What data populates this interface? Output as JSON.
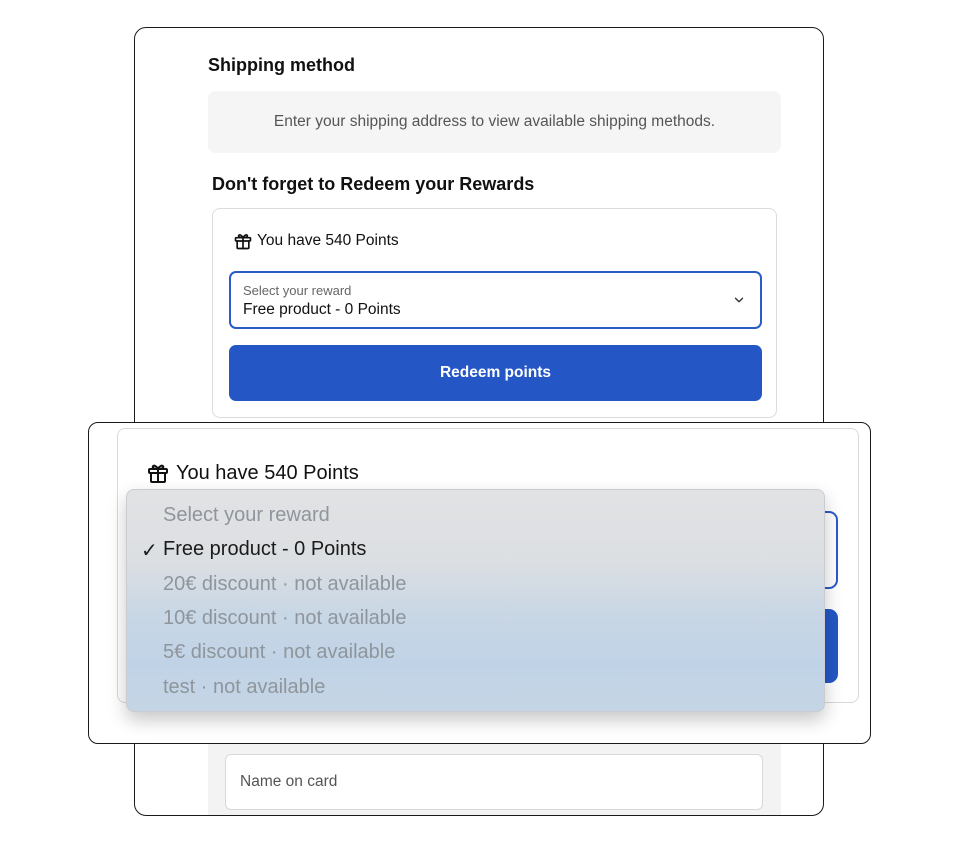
{
  "shipping": {
    "title": "Shipping method",
    "message": "Enter your shipping address to view available shipping methods."
  },
  "rewards": {
    "title": "Don't forget to Redeem your Rewards",
    "points_text": "You have 540 Points",
    "gift_icon": "gift-icon",
    "select": {
      "label": "Select your reward",
      "value": "Free product - 0 Points",
      "chevron_icon": "chevron-down-icon"
    },
    "redeem_button": "Redeem points"
  },
  "payment": {
    "name_placeholder": "Name on card"
  },
  "zoom": {
    "points_text": "You have 540 Points",
    "dropdown": {
      "placeholder": "Select your reward",
      "checkmark": "✓",
      "options": [
        "Free product - 0 Points",
        "20€ discount · not available",
        "10€ discount · not available",
        "5€ discount · not available",
        "test · not available"
      ],
      "selected_index": 0
    }
  },
  "colors": {
    "accent": "#2457c5",
    "focus_border": "#2a5bc7",
    "muted_option": "#8f959c"
  }
}
